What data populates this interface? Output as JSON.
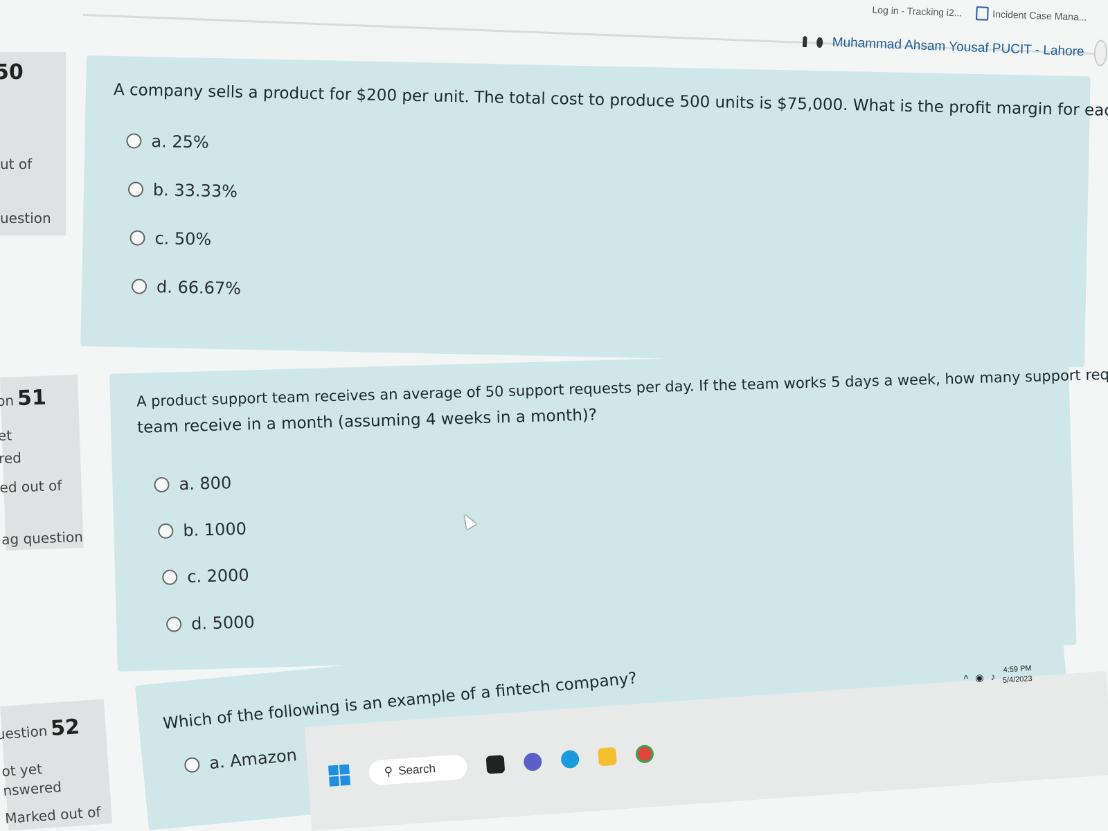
{
  "browser": {
    "bookmarks": [
      "Log in - Tracking i2...",
      "Incident Case Mana..."
    ]
  },
  "header": {
    "user_name": "Muhammad Ahsam Yousaf PUCIT - Lahore"
  },
  "nav_blocks": [
    {
      "number": "50",
      "lines": [
        "ut of",
        "uestion"
      ]
    },
    {
      "prefix": "on",
      "number": "51",
      "lines": [
        "et",
        "red",
        "ed out of",
        "ag question"
      ]
    },
    {
      "prefix": "uestion",
      "number": "52",
      "lines": [
        "ot yet",
        "nswered",
        "Marked out of"
      ]
    }
  ],
  "questions": [
    {
      "text": "A company sells a product for $200 per unit. The total cost to produce 500 units is $75,000. What is the profit margin for each unit sold?",
      "options": [
        "a. 25%",
        "b. 33.33%",
        "c. 50%",
        "d. 66.67%"
      ]
    },
    {
      "text_line1": "A product support team receives an average of 50 support requests per day. If the team works 5 days a week, how many support requests does the",
      "text_line2": "team receive in a month (assuming 4 weeks in a month)?",
      "options": [
        "a. 800",
        "b. 1000",
        "c. 2000",
        "d. 5000"
      ]
    },
    {
      "text": "Which of the following is an example of a fintech company?",
      "options": [
        "a. Amazon"
      ]
    }
  ],
  "taskbar": {
    "search_label": "Search",
    "time": "4:59 PM",
    "date": "5/4/2023"
  },
  "colors": {
    "card_bg": "#cfe7e8",
    "link_blue": "#1c5d99",
    "windows_blue": "#1f8fe0"
  }
}
